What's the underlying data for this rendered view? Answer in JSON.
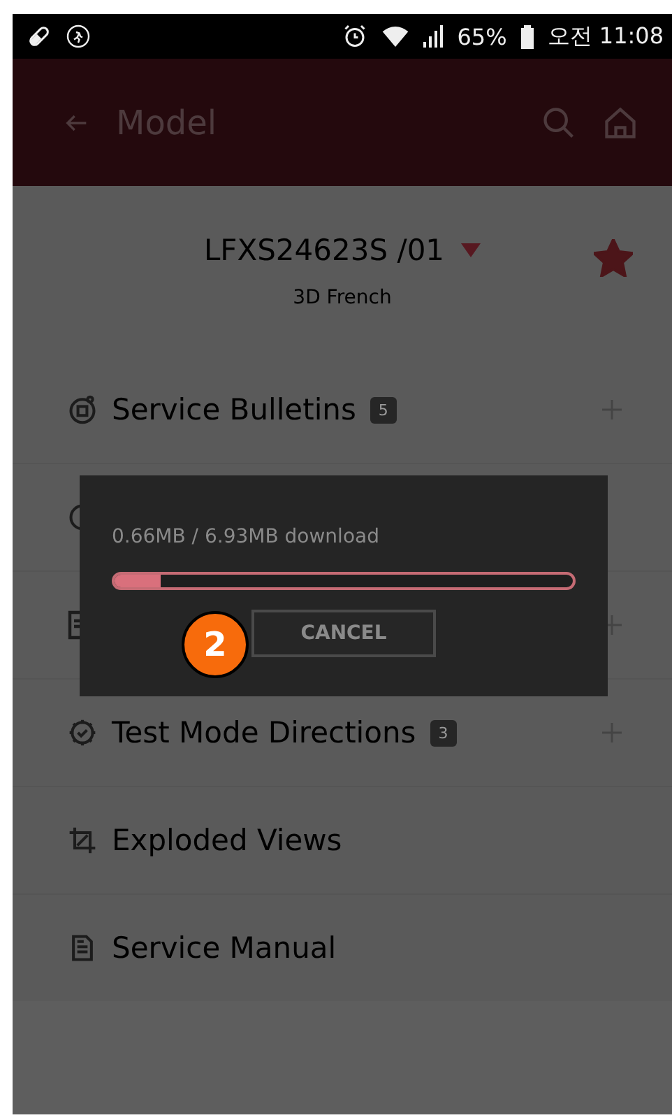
{
  "status_bar": {
    "battery_percent": "65%",
    "time": "오전 11:08"
  },
  "app_bar": {
    "title": "Model"
  },
  "model": {
    "number": "LFXS24623S /01",
    "description": "3D French",
    "favorite": true
  },
  "sections": [
    {
      "kind": "bulletin",
      "label": "Service Bulletins",
      "count": "5",
      "expandable": true
    },
    {
      "kind": "clock",
      "expandable": false
    },
    {
      "kind": "sheet",
      "expandable": true
    },
    {
      "kind": "test",
      "label": "Test Mode Directions",
      "count": "3",
      "expandable": true
    },
    {
      "kind": "exploded",
      "label": "Exploded Views",
      "expandable": false
    },
    {
      "kind": "manual",
      "label": "Service Manual",
      "expandable": false
    }
  ],
  "dialog": {
    "message": "0.66MB / 6.93MB download",
    "level": 0.1,
    "button": "CANCEL"
  },
  "annotation": {
    "number": "2"
  }
}
